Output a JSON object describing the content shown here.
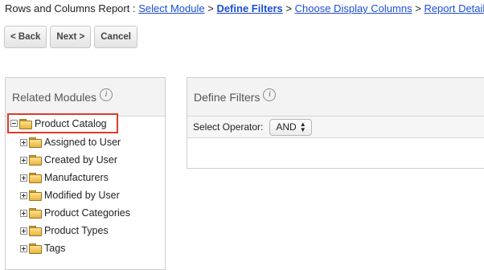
{
  "breadcrumb": {
    "prefix": "Rows and Columns Report :",
    "steps": [
      "Select Module",
      "Define Filters",
      "Choose Display Columns",
      "Report Details"
    ],
    "separator": ">"
  },
  "buttons": {
    "back": "< Back",
    "next": "Next >",
    "cancel": "Cancel"
  },
  "related_modules": {
    "title": "Related Modules",
    "info": "i",
    "root": "Product Catalog",
    "children": [
      "Assigned to User",
      "Created by User",
      "Manufacturers",
      "Modified by User",
      "Product Categories",
      "Product Types",
      "Tags"
    ]
  },
  "define_filters": {
    "title": "Define Filters",
    "info": "i",
    "operator_label": "Select Operator:",
    "operator_value": "AND"
  },
  "colors": {
    "link": "#1c4fd3",
    "highlight": "#e03a2b"
  },
  "icons": [
    "info-icon",
    "folder-icon",
    "expand-icon",
    "collapse-icon",
    "select-arrows-icon"
  ]
}
